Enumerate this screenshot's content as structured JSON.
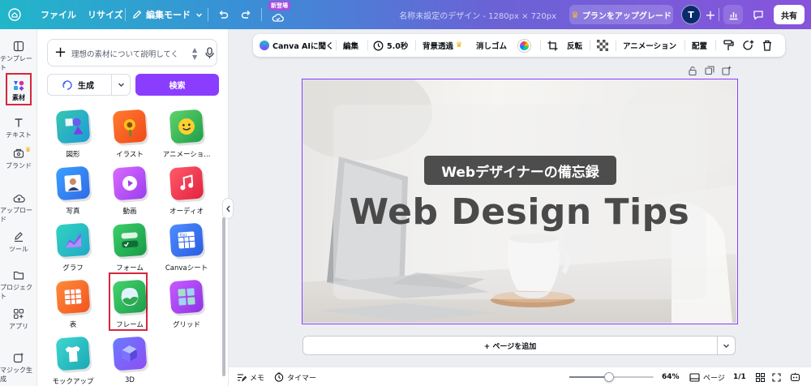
{
  "topbar": {
    "file": "ファイル",
    "resize": "リサイズ",
    "edit_mode": "編集モード",
    "new_badge": "新登場",
    "doc_title": "名称未設定のデザイン - 1280px × 720px",
    "upgrade": "プランをアップグレード",
    "avatar_initial": "T",
    "share": "共有",
    "colors": {
      "gradient_start": "#22b6c9",
      "gradient_end": "#8754dc",
      "avatar": "#0b2a6b"
    }
  },
  "rail": {
    "items": [
      {
        "label": "テンプレート",
        "icon": "layout-icon"
      },
      {
        "label": "素材",
        "icon": "shapes-icon"
      },
      {
        "label": "テキスト",
        "icon": "text-icon"
      },
      {
        "label": "ブランド",
        "icon": "brand-icon"
      },
      {
        "label": "アップロード",
        "icon": "cloud-upload-icon"
      },
      {
        "label": "ツール",
        "icon": "pen-icon"
      },
      {
        "label": "プロジェクト",
        "icon": "folder-icon"
      },
      {
        "label": "アプリ",
        "icon": "apps-icon"
      },
      {
        "label": "マジック生成",
        "icon": "magic-icon"
      }
    ]
  },
  "panel": {
    "search_placeholder": "理想の素材について説明してく",
    "generate_label": "生成",
    "search_button": "検索",
    "accent": "#8b3dff",
    "tiles": [
      {
        "label": "図形"
      },
      {
        "label": "イラスト"
      },
      {
        "label": "アニメーショ..."
      },
      {
        "label": "写真"
      },
      {
        "label": "動画"
      },
      {
        "label": "オーディオ"
      },
      {
        "label": "グラフ"
      },
      {
        "label": "フォーム"
      },
      {
        "label": "Canvaシート"
      },
      {
        "label": "表"
      },
      {
        "label": "フレーム"
      },
      {
        "label": "グリッド"
      },
      {
        "label": "モックアップ"
      },
      {
        "label": "3D"
      }
    ]
  },
  "ctxbar": {
    "ai": "Canva AIに聞く",
    "edit": "編集",
    "duration": "5.0秒",
    "bg_remove": "背景透過",
    "eraser": "消しゴム",
    "flip": "反転",
    "animation": "アニメーション",
    "arrange": "配置"
  },
  "canvas": {
    "subtitle": "Webデザイナーの備忘録",
    "title": "Web Design Tips",
    "selection_color": "#8b3dff"
  },
  "add_page": "+ ページを追加",
  "bottombar": {
    "notes": "メモ",
    "timer": "タイマー",
    "zoom": "64%",
    "zoom_level": 0.47,
    "pages_label": "ページ",
    "page_count": "1/1"
  }
}
